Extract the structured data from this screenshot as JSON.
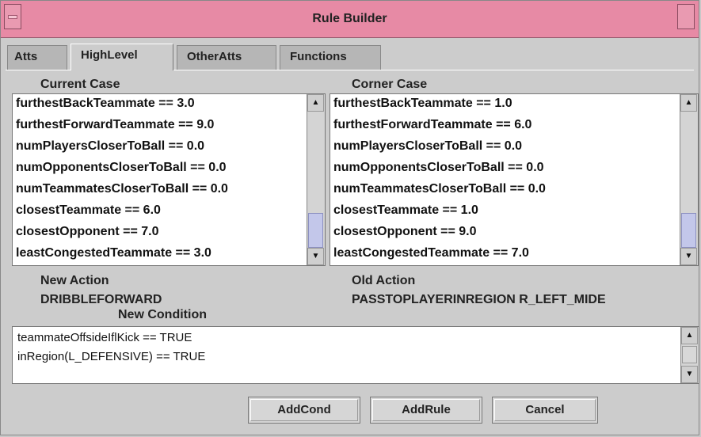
{
  "window": {
    "title": "Rule Builder"
  },
  "tabs": [
    {
      "label": "Atts"
    },
    {
      "label": "HighLevel"
    },
    {
      "label": "OtherAtts"
    },
    {
      "label": "Functions"
    }
  ],
  "current_case": {
    "label": "Current Case",
    "items": [
      "furthestBackTeammate == 3.0",
      "furthestForwardTeammate == 9.0",
      "numPlayersCloserToBall == 0.0",
      "numOpponentsCloserToBall == 0.0",
      "numTeammatesCloserToBall == 0.0",
      "closestTeammate == 6.0",
      "closestOpponent == 7.0",
      "leastCongestedTeammate == 3.0"
    ]
  },
  "corner_case": {
    "label": "Corner Case",
    "items": [
      "furthestBackTeammate == 1.0",
      "furthestForwardTeammate == 6.0",
      "numPlayersCloserToBall == 0.0",
      "numOpponentsCloserToBall == 0.0",
      "numTeammatesCloserToBall == 0.0",
      "closestTeammate == 1.0",
      "closestOpponent == 9.0",
      "leastCongestedTeammate == 7.0"
    ]
  },
  "new_action": {
    "label": "New Action",
    "value": "DRIBBLEFORWARD"
  },
  "old_action": {
    "label": "Old Action",
    "value": "PASSTOPLAYERINREGION R_LEFT_MIDE"
  },
  "new_condition": {
    "label": "New Condition",
    "items": [
      "teammateOffsideIflKick == TRUE",
      "inRegion(L_DEFENSIVE) == TRUE"
    ]
  },
  "buttons": {
    "add_cond": "AddCond",
    "add_rule": "AddRule",
    "cancel": "Cancel"
  },
  "icons": {
    "scroll_up": "▲",
    "scroll_down": "▼"
  }
}
